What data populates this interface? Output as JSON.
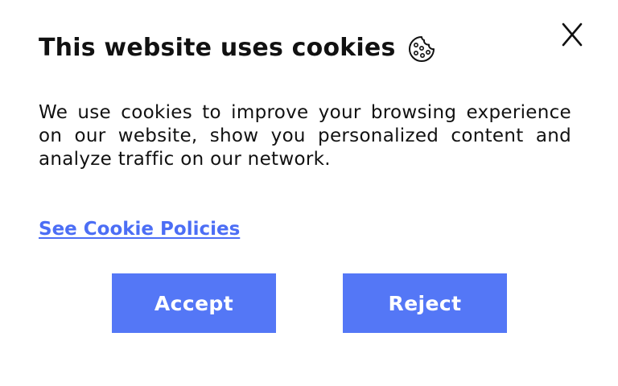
{
  "dialog": {
    "title": "This website uses cookies",
    "title_icon": "cookie-icon",
    "close_icon": "close-x-icon",
    "body": "We use cookies to improve your browsing experience on our website, show you personalized content and analyze traffic on our network.",
    "policy_link": "See Cookie Policies",
    "accept_label": "Accept",
    "reject_label": "Reject"
  },
  "colors": {
    "accent": "#5477f6",
    "link": "#4c6ef5",
    "text": "#111111",
    "background": "#ffffff"
  }
}
